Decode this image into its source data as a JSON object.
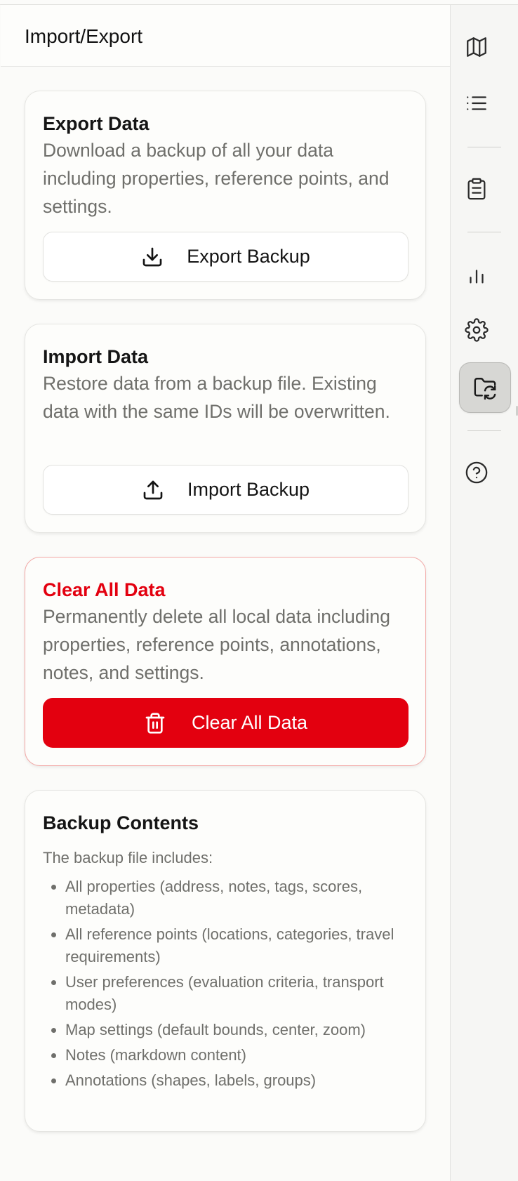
{
  "header": {
    "title": "Import/Export"
  },
  "export_card": {
    "title": "Export Data",
    "description": "Download a backup of all your data including properties, reference points, and settings.",
    "button_label": "Export Backup",
    "button_icon": "download-icon"
  },
  "import_card": {
    "title": "Import Data",
    "description": "Restore data from a backup file. Existing data with the same IDs will be overwritten.",
    "button_label": "Import Backup",
    "button_icon": "upload-icon"
  },
  "clear_card": {
    "title": "Clear All Data",
    "description": "Permanently delete all local data including properties, reference points, annotations, notes, and settings.",
    "button_label": "Clear All Data",
    "button_icon": "trash-icon",
    "accent_color": "#e3000f"
  },
  "contents_card": {
    "title": "Backup Contents",
    "intro": "The backup file includes:",
    "items": [
      "All properties (address, notes, tags, scores, metadata)",
      "All reference points (locations, categories, travel requirements)",
      "User preferences (evaluation criteria, transport modes)",
      "Map settings (default bounds, center, zoom)",
      "Notes (markdown content)",
      "Annotations (shapes, labels, groups)"
    ]
  },
  "rail": {
    "items": [
      {
        "icon": "map-icon",
        "active": false
      },
      {
        "icon": "list-icon",
        "active": false
      },
      {
        "icon": "clipboard-icon",
        "active": false
      },
      {
        "icon": "bar-chart-icon",
        "active": false
      },
      {
        "icon": "gear-icon",
        "active": false
      },
      {
        "icon": "folder-sync-icon",
        "active": true
      },
      {
        "icon": "help-circle-icon",
        "active": false
      }
    ]
  }
}
